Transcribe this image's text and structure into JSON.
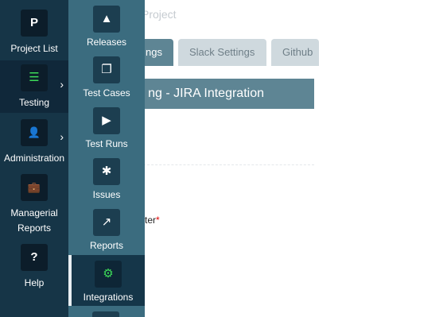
{
  "page": {
    "title_fragment": "Project",
    "tabs": [
      {
        "label": "ngs"
      },
      {
        "label": "Slack Settings"
      },
      {
        "label": "Github"
      }
    ],
    "section_title": "ng - JIRA Integration",
    "field_label": "ter",
    "required_mark": "*"
  },
  "nav": {
    "items": [
      {
        "label": "Project List",
        "icon": "project-list-icon",
        "glyph": "P"
      },
      {
        "label": "Testing",
        "icon": "testing-list-icon",
        "glyph": "☰"
      },
      {
        "label": "Administration",
        "icon": "administration-icon",
        "glyph": "👤"
      },
      {
        "label": "Managerial Reports",
        "icon": "briefcase-icon",
        "glyph": "💼"
      },
      {
        "label": "Help",
        "icon": "question-icon",
        "glyph": "?"
      }
    ],
    "chevron": "›"
  },
  "submenu": {
    "items": [
      {
        "label": "Releases",
        "icon": "road-icon",
        "glyph": "▲"
      },
      {
        "label": "Test Cases",
        "icon": "copy-icon",
        "glyph": "❐"
      },
      {
        "label": "Test Runs",
        "icon": "play-icon",
        "glyph": "▶"
      },
      {
        "label": "Issues",
        "icon": "bug-icon",
        "glyph": "✱"
      },
      {
        "label": "Reports",
        "icon": "chart-line-icon",
        "glyph": "↗"
      },
      {
        "label": "Integrations",
        "icon": "cogs-icon",
        "glyph": "⚙"
      }
    ]
  },
  "colors": {
    "nav_bg": "#163547",
    "submenu_bg": "#3b6c7f",
    "active_bg": "#153649",
    "accent_green": "#3ddb58",
    "section_bar": "#5e8594"
  }
}
